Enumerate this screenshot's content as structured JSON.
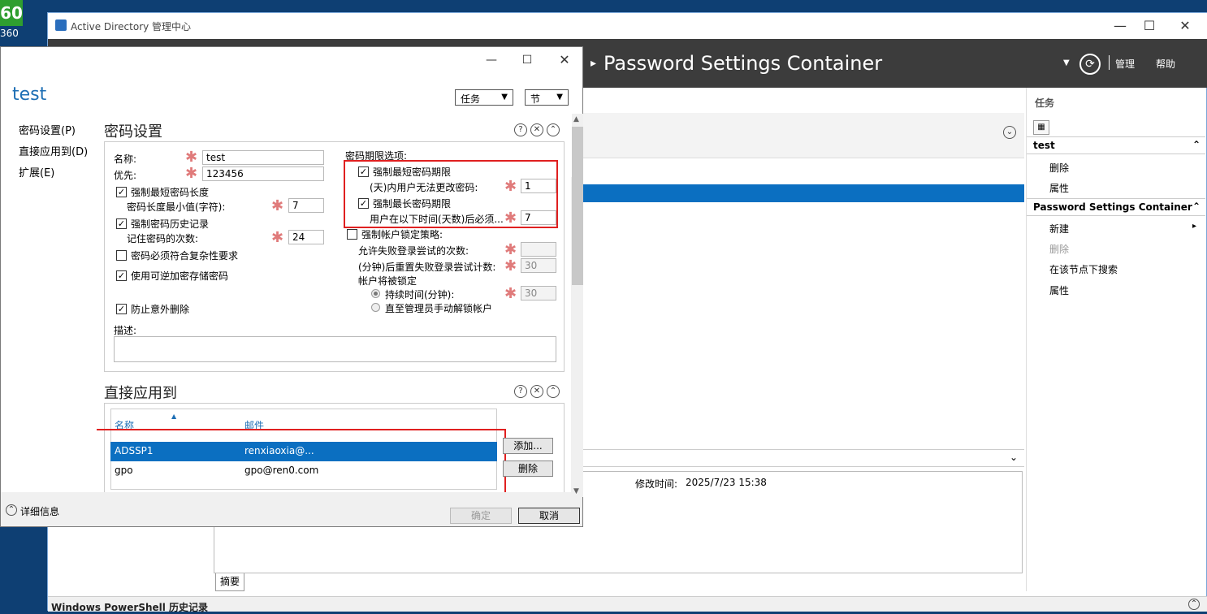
{
  "desktop": {
    "badge": "60",
    "badge_label": "360"
  },
  "main_window": {
    "title": "Active Directory 管理中心",
    "breadcrumb": "Password Settings Container",
    "nav_manage": "管理",
    "nav_help": "帮助",
    "modified_label": "修改时间:",
    "modified_value": "2025/7/23 15:38",
    "summary_tab": "摘要",
    "powershell_history": "Windows PowerShell 历史记录"
  },
  "task_pane": {
    "header": "任务",
    "sections": [
      {
        "title": "test",
        "items": [
          "删除",
          "属性"
        ]
      },
      {
        "title": "Password Settings Container",
        "items": [
          "新建",
          "删除",
          "在该节点下搜索",
          "属性"
        ]
      }
    ]
  },
  "dialog": {
    "title": "test",
    "tasks_dropdown": "任务",
    "sections_dropdown": "节",
    "nav": [
      "密码设置(P)",
      "直接应用到(D)",
      "扩展(E)"
    ],
    "password_settings": {
      "section_title": "密码设置",
      "name_label": "名称:",
      "name_value": "test",
      "priority_label": "优先:",
      "priority_value": "123456",
      "min_length_enforce": "强制最短密码长度",
      "min_length_label": "密码长度最小值(字符):",
      "min_length_value": "7",
      "history_enforce": "强制密码历史记录",
      "history_label": "记住密码的次数:",
      "history_value": "24",
      "complexity": "密码必须符合复杂性要求",
      "reversible": "使用可逆加密存储密码",
      "protect_delete": "防止意外删除",
      "description_label": "描述:",
      "age_options_label": "密码期限选项:",
      "min_age_enforce": "强制最短密码期限",
      "min_age_label": "(天)内用户无法更改密码:",
      "min_age_value": "1",
      "max_age_enforce": "强制最长密码期限",
      "max_age_label": "用户在以下时间(天数)后必须...",
      "max_age_value": "7",
      "lockout_enforce": "强制帐户锁定策略:",
      "lockout_attempts_label": "允许失败登录尝试的次数:",
      "lockout_reset_label": "(分钟)后重置失败登录尝试计数:",
      "lockout_reset_value": "30",
      "lockout_will_label": "帐户将被锁定",
      "lockout_duration_label": "持续时间(分钟):",
      "lockout_duration_value": "30",
      "lockout_manual_label": "直至管理员手动解锁帐户"
    },
    "applies_to": {
      "section_title": "直接应用到",
      "col_name": "名称",
      "col_mail": "邮件",
      "rows": [
        {
          "name": "ADSSP1",
          "mail": "renxiaoxia@..."
        },
        {
          "name": "gpo",
          "mail": "gpo@ren0.com"
        }
      ],
      "add_button": "添加...",
      "remove_button": "删除"
    },
    "details_toggle": "详细信息",
    "ok_button": "确定",
    "cancel_button": "取消"
  }
}
